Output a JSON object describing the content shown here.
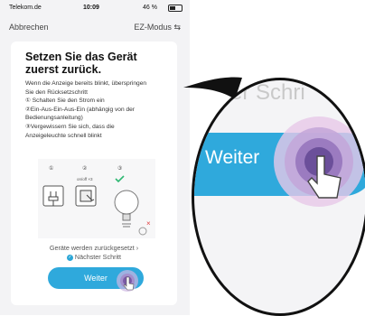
{
  "statusbar": {
    "carrier": "Telekom.de",
    "time": "10:09",
    "battery": "46 %",
    "battery_level": 0.46
  },
  "nav": {
    "cancel": "Abbrechen",
    "mode": "EZ-Modus",
    "mode_icon": "switch-arrows-icon"
  },
  "card": {
    "title_line1": "Setzen Sie das Gerät",
    "title_line2": "zuerst zurück.",
    "body": [
      "Wenn die Anzeige bereits blinkt, überspringen",
      "Sie den Rücksetzschritt",
      "① Schalten Sie den Strom ein",
      "②Ein-Aus-Ein-Aus-Ein (abhängig von der",
      "Bedienungsanleitung)",
      "③Vergewissern Sie sich, dass die",
      "Anzeigeleuchte schnell blinkt"
    ],
    "illus_labels": [
      "①",
      "②",
      "③"
    ],
    "illus_step2_caption": "on/off ×3",
    "reset_link": "Geräte werden zurückgesetzt ›",
    "next_step": "Nächster Schritt",
    "button": "Weiter"
  },
  "zoom": {
    "faint_text": "er Schri",
    "button": "Weiter"
  },
  "colors": {
    "accent": "#2fa9dc",
    "touch": "#7b5aa6"
  }
}
